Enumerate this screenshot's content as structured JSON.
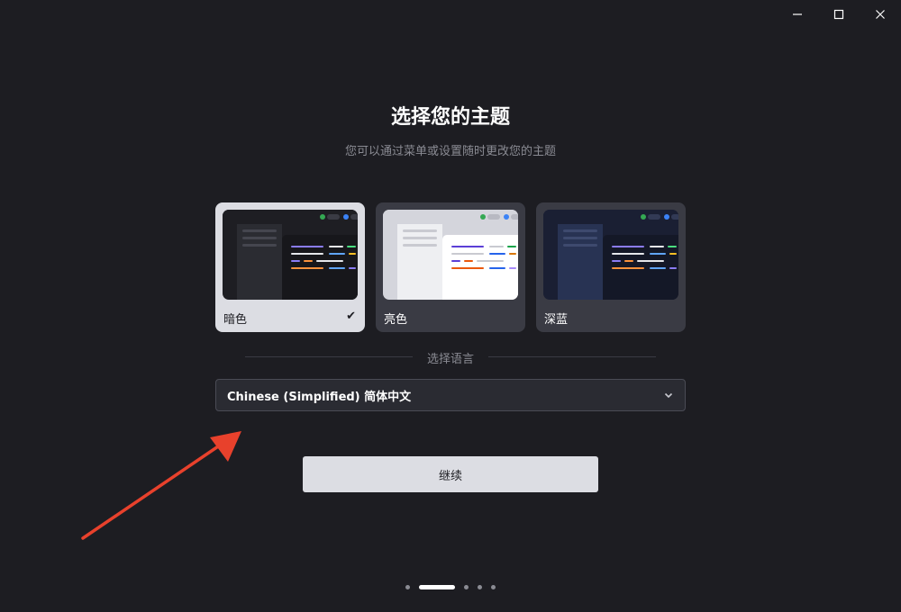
{
  "window": {
    "controls": [
      "minimize-icon",
      "maximize-icon",
      "close-icon"
    ]
  },
  "header": {
    "title": "选择您的主题",
    "subtitle": "您可以通过菜单或设置随时更改您的主题"
  },
  "themes": [
    {
      "label": "暗色",
      "selected": true,
      "icon": "checkmark-icon"
    },
    {
      "label": "亮色",
      "selected": false
    },
    {
      "label": "深蓝",
      "selected": false
    }
  ],
  "language": {
    "section_label": "选择语言",
    "selected_value": "Chinese (Simplified) 简体中文",
    "icon": "chevron-down-icon"
  },
  "actions": {
    "continue_label": "继续"
  },
  "pager": {
    "total": 5,
    "current": 2
  },
  "annotation": {
    "arrow_color": "#e8412c"
  },
  "colors": {
    "background": "#1d1d22",
    "card": "#3a3b44",
    "card_selected": "#dcdde3",
    "button": "#dcdde3"
  }
}
